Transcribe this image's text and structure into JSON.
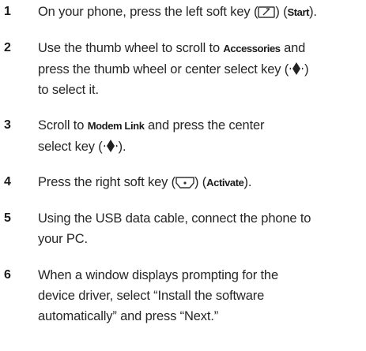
{
  "steps": [
    {
      "number": "1",
      "text_a": "On your phone, press the left soft key (",
      "icon": "left-soft-key-icon",
      "text_b": ") (",
      "term": "Start",
      "text_c": ")."
    },
    {
      "number": "2",
      "line1_a": "Use the thumb wheel to scroll to ",
      "term": "Accessories",
      "line1_b": " and",
      "line2_a": "press the thumb wheel or center select key (",
      "icon": "center-select-key-icon",
      "line2_b": ")",
      "line3": "to select it."
    },
    {
      "number": "3",
      "line1_a": "Scroll to ",
      "term": "Modem Link",
      "line1_b": " and press the center",
      "line2_a": "select key (",
      "icon": "center-select-key-icon",
      "line2_b": ")."
    },
    {
      "number": "4",
      "text_a": "Press the right soft key (",
      "icon": "right-soft-key-icon",
      "text_b": ") (",
      "term": "Activate",
      "text_c": ")."
    },
    {
      "number": "5",
      "line1": "Using the USB data cable, connect the phone to",
      "line2": "your PC."
    },
    {
      "number": "6",
      "line1": "When a window displays prompting for the",
      "line2": "device driver, select “Install the software",
      "line3": "automatically” and press “Next.”"
    }
  ]
}
